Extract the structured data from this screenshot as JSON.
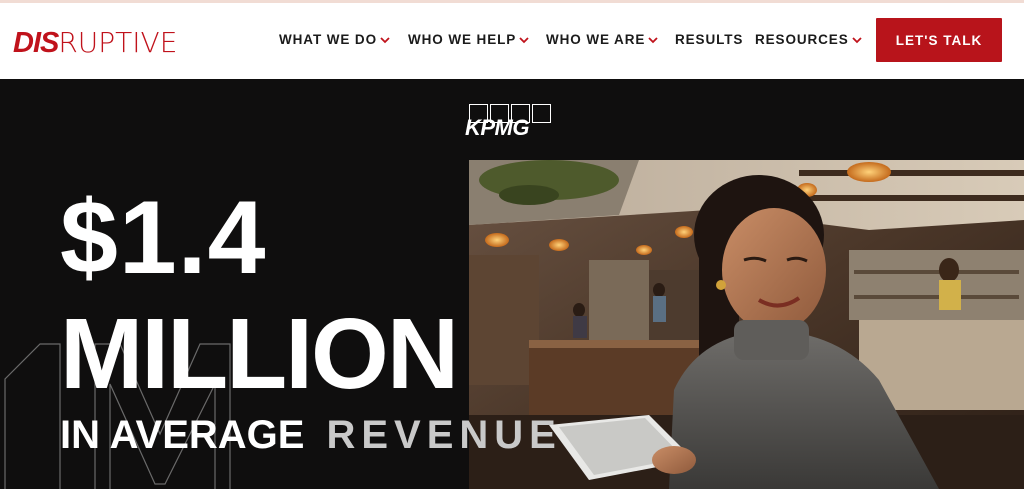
{
  "brand": {
    "logo_bold": "DIS",
    "logo_thin": "RUPTIVE",
    "accent": "#c0121b"
  },
  "nav": {
    "items": [
      {
        "label": "WHAT WE DO",
        "has_dropdown": true
      },
      {
        "label": "WHO WE HELP",
        "has_dropdown": true
      },
      {
        "label": "WHO WE ARE",
        "has_dropdown": true
      },
      {
        "label": "RESULTS",
        "has_dropdown": false
      },
      {
        "label": "RESOURCES",
        "has_dropdown": true
      }
    ],
    "cta_label": "LET'S TALK",
    "cta_color": "#b8141b"
  },
  "hero": {
    "client_logo_text": "KPMG",
    "headline_amount": "$1.4",
    "headline_unit": "MILLION",
    "subline_1": "IN AVERAGE",
    "subline_2": "REVENUE",
    "background": "#0f0e0e"
  }
}
